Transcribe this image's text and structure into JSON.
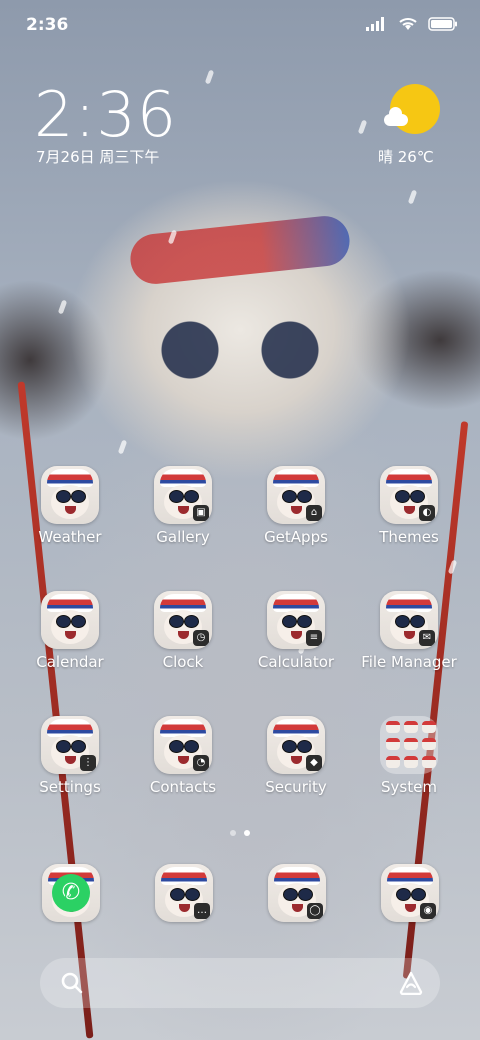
{
  "status_bar": {
    "time": "2:36"
  },
  "lock_clock": {
    "time": "2:36",
    "date": "7月26日 周三下午"
  },
  "weather_widget": {
    "text": "晴 26℃"
  },
  "apps": [
    {
      "label": "Weather",
      "badge": "",
      "icon": "weather-app-icon"
    },
    {
      "label": "Gallery",
      "badge": "▣",
      "icon": "gallery-app-icon"
    },
    {
      "label": "GetApps",
      "badge": "⌂",
      "icon": "getapps-app-icon"
    },
    {
      "label": "Themes",
      "badge": "◐",
      "icon": "themes-app-icon"
    },
    {
      "label": "Calendar",
      "badge": "",
      "icon": "calendar-app-icon"
    },
    {
      "label": "Clock",
      "badge": "◷",
      "icon": "clock-app-icon"
    },
    {
      "label": "Calculator",
      "badge": "≡",
      "icon": "calculator-app-icon"
    },
    {
      "label": "File Manager",
      "badge": "✉",
      "icon": "file-manager-app-icon"
    },
    {
      "label": "Settings",
      "badge": "⋮",
      "icon": "settings-app-icon"
    },
    {
      "label": "Contacts",
      "badge": "◔",
      "icon": "contacts-app-icon"
    },
    {
      "label": "Security",
      "badge": "◆",
      "icon": "security-app-icon"
    },
    {
      "label": "System",
      "badge": "",
      "icon": "system-folder-icon"
    }
  ],
  "dock": [
    {
      "icon": "phone-app-icon"
    },
    {
      "icon": "messaging-app-icon"
    },
    {
      "icon": "browser-app-icon"
    },
    {
      "icon": "camera-app-icon"
    }
  ],
  "page_indicator": {
    "count": 2,
    "active": 1
  },
  "colors": {
    "sun": "#f6c713",
    "phone_green": "#2bd164",
    "hat_red": "#d23a3a",
    "hat_blue": "#2d4aa0"
  }
}
